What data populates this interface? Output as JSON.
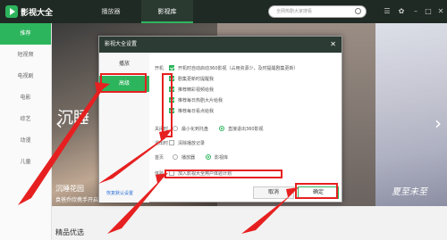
{
  "app": {
    "title": "影视大全"
  },
  "tabs": [
    {
      "label": "播放器"
    },
    {
      "label": "影视库"
    }
  ],
  "search": {
    "placeholder": "全网热剧大家搜看"
  },
  "sidebar": {
    "items": [
      {
        "label": "推荐"
      },
      {
        "label": "短视频"
      },
      {
        "label": "电视剧"
      },
      {
        "label": "电影"
      },
      {
        "label": "综艺"
      },
      {
        "label": "动漫"
      },
      {
        "label": "儿童"
      }
    ]
  },
  "content": {
    "poster_title": "沉睡",
    "poster_name": "沉睡花园",
    "poster_caption": "袁爸乔欣携手开启浪漫",
    "poster_right_title": "夏至未至",
    "section_title": "精品优选"
  },
  "dialog": {
    "title": "影视大全设置",
    "nav": [
      {
        "label": "播放"
      },
      {
        "label": "高级"
      }
    ],
    "startup_label": "开机",
    "startup_options": [
      "开机时自动启动360影视（占用资源少，及时提醒剧集更新）",
      "剧集更新时提醒我",
      "推荐精彩视频给我",
      "推荐每日热剧大片给我",
      "推荐每日看点给我"
    ],
    "close_label": "关闭时",
    "close_options": [
      "最小化到托盘",
      "直接退出360影视"
    ],
    "exit_label": "退出时",
    "exit_option": "清除播放记录",
    "home_label": "首页",
    "home_options": [
      "播放器",
      "影视库"
    ],
    "experience_label": "体验",
    "experience_option": "加入影视大全用户体验计划",
    "restore_label": "恢复默认设置",
    "ok_label": "确定",
    "cancel_label": "取消"
  },
  "colors": {
    "accent": "#2db55d",
    "highlight": "#e62020",
    "titlebar": "#1f2a24"
  }
}
